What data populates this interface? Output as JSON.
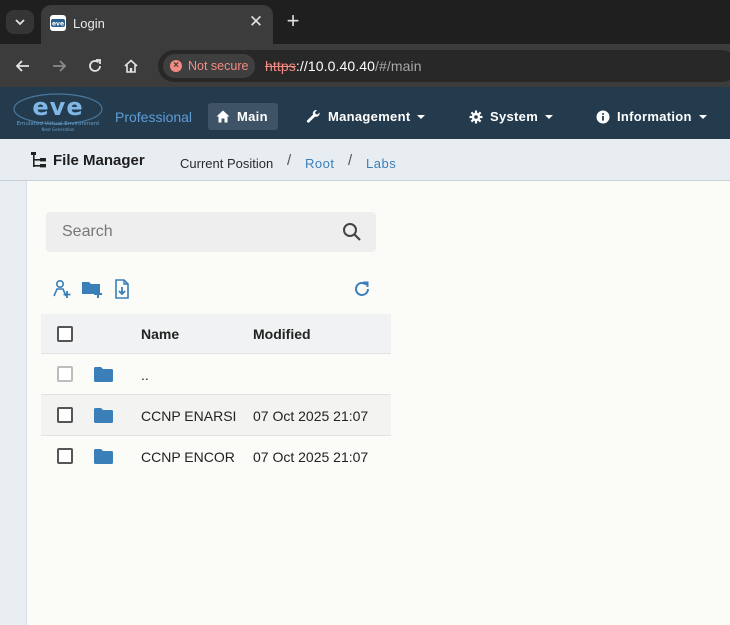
{
  "browser": {
    "tab_title": "Login",
    "security_label": "Not secure",
    "url_scheme": "https",
    "url_host": "://10.0.40.40",
    "url_path": "/#/main"
  },
  "navbar": {
    "edition": "Professional",
    "items": [
      {
        "label": "Main",
        "icon": "home-icon",
        "active": true
      },
      {
        "label": "Management",
        "icon": "wrench-icon"
      },
      {
        "label": "System",
        "icon": "gear-icon"
      },
      {
        "label": "Information",
        "icon": "info-icon"
      }
    ],
    "logo_text": "eve",
    "logo_tagline": "Emulated Virtual Environment",
    "logo_subtagline": "Next Generation"
  },
  "breadcrumb": {
    "title": "File Manager",
    "current_label": "Current Position",
    "items": [
      "Root",
      "Labs"
    ]
  },
  "search": {
    "placeholder": "Search"
  },
  "table": {
    "columns": [
      "Name",
      "Modified"
    ],
    "rows": [
      {
        "name": "..",
        "modified": ""
      },
      {
        "name": "CCNP ENARSI",
        "modified": "07 Oct 2025 21:07"
      },
      {
        "name": "CCNP ENCOR",
        "modified": "07 Oct 2025 21:07"
      }
    ]
  },
  "colors": {
    "navbar_bg": "#243b4e",
    "accent": "#3a7fb8",
    "folder": "#3a7fb8"
  }
}
